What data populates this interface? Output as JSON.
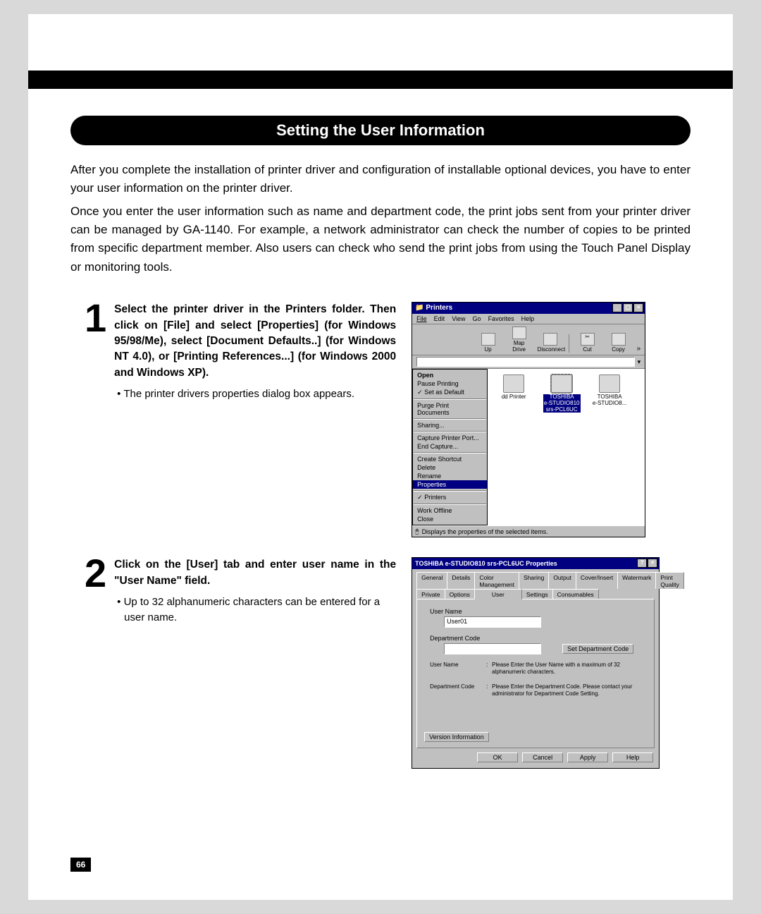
{
  "header_title": "Setting the User Information",
  "intro": {
    "p1": "After you complete the installation of printer driver and configuration of installable optional devices, you have to enter your user information on the printer driver.",
    "p2": "Once you enter the user information such as name and department code, the print jobs sent from your printer driver can be managed by GA-1140.  For example, a network administrator can check the number of copies to be printed from specific department member.  Also users can check who send the print jobs from using the Touch Panel Display or monitoring tools."
  },
  "step1": {
    "num": "1",
    "title": "Select the printer driver in the Printers folder. Then click on [File] and select [Properties] (for Windows 95/98/Me), select [Document Defaults..] (for Windows NT 4.0), or [Printing References...] (for Windows 2000 and Windows XP).",
    "bullet": "The printer drivers properties dialog box appears."
  },
  "step2": {
    "num": "2",
    "title": "Click on the [User] tab and enter user name in the \"User Name\" field.",
    "bullet": "Up to 32 alphanumeric characters can be entered for a user name."
  },
  "printers_window": {
    "title": "Printers",
    "menus": {
      "file": "File",
      "edit": "Edit",
      "view": "View",
      "go": "Go",
      "favorites": "Favorites",
      "help": "Help"
    },
    "tools": {
      "up": "Up",
      "mapdrive": "Map Drive",
      "disconnect": "Disconnect",
      "cut": "Cut",
      "copy": "Copy"
    },
    "file_menu": {
      "open": "Open",
      "pause": "Pause Printing",
      "setdefault": "Set as Default",
      "purge": "Purge Print Documents",
      "sharing": "Sharing...",
      "capture": "Capture Printer Port...",
      "endcapture": "End Capture...",
      "shortcut": "Create Shortcut",
      "delete": "Delete",
      "rename": "Rename",
      "properties": "Properties",
      "printers": "Printers",
      "workoffline": "Work Offline",
      "close": "Close"
    },
    "icons": {
      "addprinter": "dd Printer",
      "sel_line1": "TOSHIBA",
      "sel_line2": "e-STUDIO810",
      "sel_line3": "srs-PCL6UC",
      "other_line1": "TOSHIBA",
      "other_line2": "e-STUDIO8..."
    },
    "status": "Displays the properties of the selected items."
  },
  "dialog": {
    "title": "TOSHIBA e-STUDIO810 srs-PCL6UC Properties",
    "tabs_row1": {
      "general": "General",
      "details": "Details",
      "color": "Color Management",
      "sharing": "Sharing",
      "output": "Output",
      "cover": "Cover/Insert",
      "watermark": "Watermark",
      "printquality": "Print Quality"
    },
    "tabs_row2": {
      "private": "Private",
      "options": "Options",
      "user": "User",
      "settings": "Settings",
      "consumables": "Consumables"
    },
    "user_name_label": "User Name",
    "user_name_value": "User01",
    "dept_code_label": "Department Code",
    "set_dept_btn": "Set Department Code",
    "hint_user_label": "User Name",
    "hint_user_text": "Please Enter the User Name with a maximum of 32 alphanumeric characters.",
    "hint_dept_label": "Department Code",
    "hint_dept_text": "Please Enter the Department Code. Please contact your administrator for Department Code Setting.",
    "version_btn": "Version Information",
    "buttons": {
      "ok": "OK",
      "cancel": "Cancel",
      "apply": "Apply",
      "help": "Help"
    }
  },
  "page_number": "66"
}
